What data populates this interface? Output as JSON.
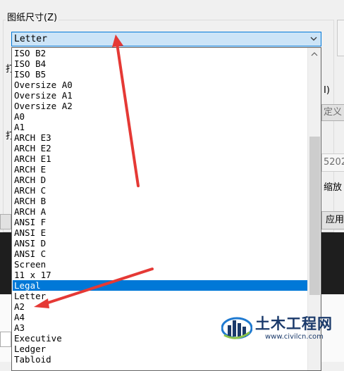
{
  "section": {
    "label": "图纸尺寸(Z)"
  },
  "paper_size_combo": {
    "value": "Letter"
  },
  "right_fragments": {
    "label_i": "I)",
    "btn_custom": "定义",
    "field_value": "5202",
    "label_scale": "缩放",
    "btn_apply": "应用"
  },
  "left_fragments": {
    "a": "打",
    "b": "打"
  },
  "dropdown": {
    "items": [
      "ISO B2",
      "ISO B4",
      "ISO B5",
      "Oversize A0",
      "Oversize A1",
      "Oversize A2",
      "A0",
      "A1",
      "ARCH E3",
      "ARCH E2",
      "ARCH E1",
      "ARCH E",
      "ARCH D",
      "ARCH C",
      "ARCH B",
      "ARCH A",
      "ANSI F",
      "ANSI E",
      "ANSI D",
      "ANSI C",
      "Screen",
      "11 x 17",
      "Legal",
      "Letter",
      "A2",
      "A4",
      "A3",
      "Executive",
      "Ledger",
      "Tabloid"
    ],
    "selected_index": 22
  },
  "watermark": {
    "title": "土木工程网",
    "url": "www.civilcn.com"
  },
  "colors": {
    "accent": "#0078d7",
    "annotation_arrow": "#e53935",
    "watermark_blue": "#1b3a6b"
  },
  "icons": {
    "combo_arrow": "chevron-down-icon",
    "scroll_up": "scroll-up-arrow-icon"
  }
}
